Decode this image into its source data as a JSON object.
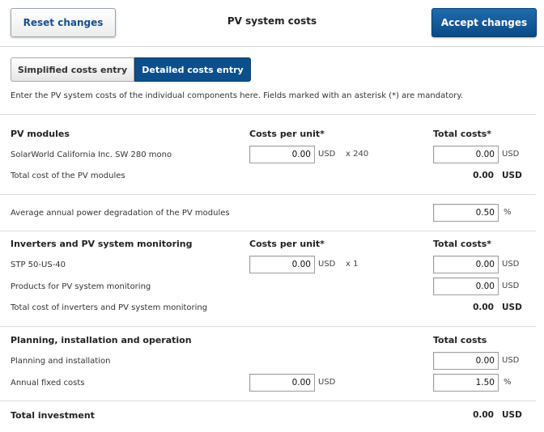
{
  "header": {
    "reset_label": "Reset changes",
    "title": "PV system costs",
    "accept_label": "Accept changes"
  },
  "tabs": [
    {
      "label": "Simplified costs entry",
      "active": false
    },
    {
      "label": "Detailed costs entry",
      "active": true
    }
  ],
  "intro": "Enter the PV system costs of the individual components here. Fields marked with an asterisk (*) are mandatory.",
  "pv_modules": {
    "heading": "PV modules",
    "col_unit": "Costs per unit*",
    "col_total": "Total costs*",
    "module_name": "SolarWorld California Inc. SW 280 mono",
    "unit_cost": "0.00",
    "unit_currency": "USD",
    "quantity": "x 240",
    "total_cost": "0.00",
    "total_currency": "USD",
    "sum_label": "Total cost of the PV modules",
    "sum_value": "0.00",
    "sum_currency": "USD"
  },
  "degradation": {
    "label": "Average annual power degradation of the PV modules",
    "value": "0.50",
    "unit": "%"
  },
  "inverters": {
    "heading": "Inverters and PV system monitoring",
    "col_unit": "Costs per unit*",
    "col_total": "Total costs*",
    "inverter_name": "STP 50-US-40",
    "unit_cost": "0.00",
    "unit_currency": "USD",
    "quantity": "x 1",
    "total_cost": "0.00",
    "total_currency": "USD",
    "monitoring_label": "Products for PV system monitoring",
    "monitoring_cost": "0.00",
    "monitoring_currency": "USD",
    "sum_label": "Total cost of inverters and PV system monitoring",
    "sum_value": "0.00",
    "sum_currency": "USD"
  },
  "planning": {
    "heading": "Planning, installation and operation",
    "col_total": "Total costs",
    "install_label": "Planning and installation",
    "install_cost": "0.00",
    "install_currency": "USD",
    "fixed_label": "Annual fixed costs",
    "fixed_unit_cost": "0.00",
    "fixed_unit_currency": "USD",
    "fixed_total": "1.50",
    "fixed_total_unit": "%"
  },
  "total": {
    "label": "Total investment",
    "value": "0.00",
    "currency": "USD"
  }
}
